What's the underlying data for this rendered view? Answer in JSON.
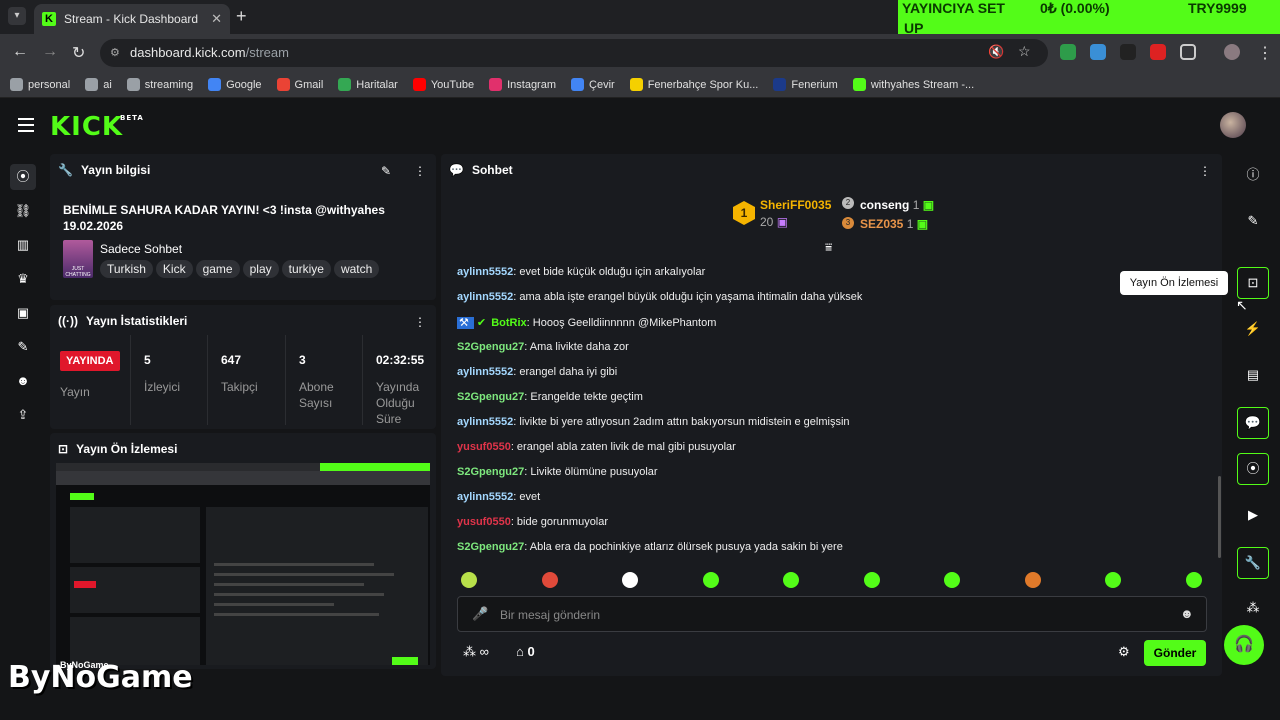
{
  "browser": {
    "tab_title": "Stream - Kick Dashboard",
    "url_domain": "dashboard.kick.com",
    "url_path": "/stream",
    "overlay_banner": [
      "YAYINCIYA SET",
      "UP",
      "0₺ (0.00%)",
      "TRY9999"
    ]
  },
  "bookmarks": [
    {
      "label": "personal",
      "icon": "folder-icon",
      "color": "#9aa0a6"
    },
    {
      "label": "ai",
      "icon": "folder-icon",
      "color": "#9aa0a6"
    },
    {
      "label": "streaming",
      "icon": "folder-icon",
      "color": "#9aa0a6"
    },
    {
      "label": "Google",
      "icon": "google-icon",
      "color": "#4285f4"
    },
    {
      "label": "Gmail",
      "icon": "gmail-icon",
      "color": "#ea4335"
    },
    {
      "label": "Haritalar",
      "icon": "maps-icon",
      "color": "#34a853"
    },
    {
      "label": "YouTube",
      "icon": "youtube-icon",
      "color": "#ff0000"
    },
    {
      "label": "Instagram",
      "icon": "instagram-icon",
      "color": "#e1306c"
    },
    {
      "label": "Çevir",
      "icon": "translate-icon",
      "color": "#4285f4"
    },
    {
      "label": "Fenerbahçe Spor Ku...",
      "icon": "fenerbahce-icon",
      "color": "#f5d000"
    },
    {
      "label": "Fenerium",
      "icon": "fenerium-icon",
      "color": "#1b3a8a"
    },
    {
      "label": "withyahes Stream -...",
      "icon": "kick-icon",
      "color": "#53fc18"
    }
  ],
  "header": {
    "logo": "KICK",
    "logo_badge": "BETA"
  },
  "stream_info": {
    "title": "Yayın bilgisi",
    "stream_title": "BENİMLE SAHURA KADAR YAYIN! <3 !insta @withyahes",
    "date": "19.02.2026",
    "category": "Sadece Sohbet",
    "category_thumb": "JUST CHATTING",
    "tags": [
      "Turkish",
      "Kick",
      "game",
      "play",
      "turkiye",
      "watch"
    ]
  },
  "stream_stats": {
    "title": "Yayın İstatistikleri",
    "status_badge": "YAYINDA",
    "status_label": "Yayın",
    "stats": [
      {
        "value": "5",
        "label": "İzleyici"
      },
      {
        "value": "647",
        "label": "Takipçi"
      },
      {
        "value": "3",
        "label": "Abone Sayısı"
      },
      {
        "value": "02:32:55",
        "label": "Yayında Olduğu Süre"
      }
    ]
  },
  "preview": {
    "title": "Yayın Ön İzlemesi"
  },
  "chat": {
    "title": "Sohbet",
    "leaderboard": {
      "first": {
        "name": "SheriFF0035",
        "count": "20",
        "rank": "1"
      },
      "second": {
        "name": "conseng",
        "count": "1",
        "rank": "2"
      },
      "third": {
        "name": "SEZ035",
        "count": "1",
        "rank": "3"
      }
    },
    "messages": [
      {
        "user": "aylinn5552",
        "text": ": evet bide küçük olduğu için arkalıyolar",
        "color": "#a4d8ff"
      },
      {
        "user": "aylinn5552",
        "text": ": ama abla işte erangel büyük olduğu için yaşama ihtimalin daha yüksek",
        "color": "#a4d8ff"
      },
      {
        "user": "BotRix",
        "text": ": Hoooş Geelldiinnnnn @MikePhantom",
        "color": "#53fc18"
      },
      {
        "user": "S2Gpengu27",
        "text": ": Ama livikte daha zor",
        "color": "#7ee87e"
      },
      {
        "user": "aylinn5552",
        "text": ": erangel daha iyi gibi",
        "color": "#a4d8ff"
      },
      {
        "user": "S2Gpengu27",
        "text": ": Erangelde tekte geçtim",
        "color": "#7ee87e"
      },
      {
        "user": "aylinn5552",
        "text": ": livikte bi yere atlıyosun 2adım attın bakıyorsun midistein e gelmişsin",
        "color": "#a4d8ff"
      },
      {
        "user": "yusuf0550",
        "text": ": erangel abla zaten livik de mal gibi pusuyolar",
        "color": "#e0344a"
      },
      {
        "user": "S2Gpengu27",
        "text": ": Livikte ölümüne pusuyolar",
        "color": "#7ee87e"
      },
      {
        "user": "aylinn5552",
        "text": ": evet",
        "color": "#a4d8ff"
      },
      {
        "user": "yusuf0550",
        "text": ": bide gorunmuyolar",
        "color": "#e0344a"
      },
      {
        "user": "S2Gpengu27",
        "text": ": Abla era da pochinkiye atlarız ölürsek pusuya yada sakin bi yere",
        "color": "#7ee87e"
      }
    ],
    "input_placeholder": "Bir mesaj gönderin",
    "points_value": "∞",
    "store_value": "0",
    "send_label": "Gönder"
  },
  "right_rail": {
    "tooltip": "Yayın Ön İzlemesi"
  },
  "watermark": {
    "text": "ByNoGame",
    "small": "ByNoGame"
  },
  "colors": {
    "accent": "#53fc18",
    "live_red": "#e0172b"
  }
}
